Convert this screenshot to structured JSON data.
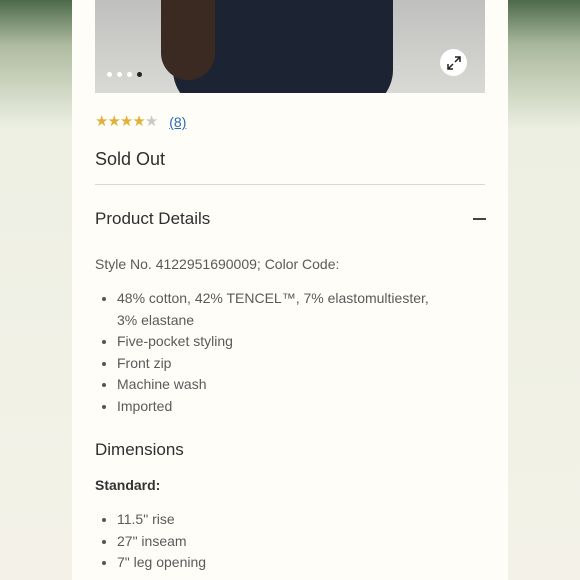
{
  "gallery": {
    "dot_count": 4,
    "active_dot": 4,
    "expand_icon": "expand-arrows-icon"
  },
  "rating": {
    "stars": 4,
    "max_stars": 5,
    "count_label": "(8)",
    "star_color": "#e0b23a"
  },
  "status": "Sold Out",
  "product_details": {
    "title": "Product Details",
    "toggle_icon": "minus-icon",
    "style_line": "Style No. 4122951690009; Color Code:",
    "bullets": [
      "48% cotton, 42% TENCEL™, 7% elastomultiester,",
      "3% elastane",
      "Five-pocket styling",
      "Front zip",
      "Machine wash",
      "Imported"
    ]
  },
  "dimensions": {
    "title": "Dimensions",
    "standard_label": "Standard:",
    "items": [
      "11.5\" rise",
      "27\" inseam",
      "7\" leg opening"
    ]
  }
}
